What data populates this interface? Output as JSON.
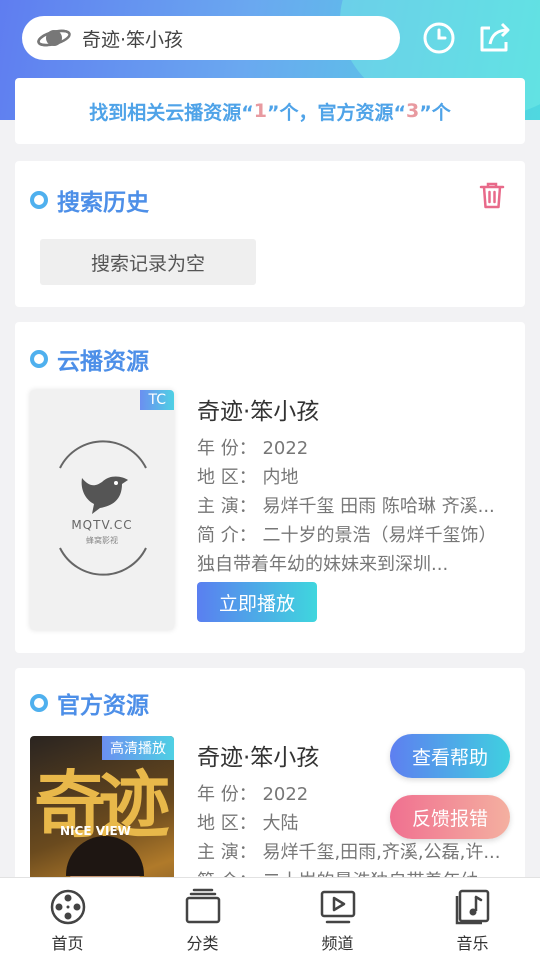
{
  "header": {
    "search_query": "奇迹·笨小孩",
    "clock_icon": "clock-icon",
    "share_icon": "share-icon"
  },
  "result_summary": {
    "prefix": "找到相关云播资源“",
    "cloud_count": "1",
    "middle": "”个，官方资源“",
    "official_count": "3",
    "suffix": "”个"
  },
  "history": {
    "title": "搜索历史",
    "empty_label": "搜索记录为空"
  },
  "cloud": {
    "title": "云播资源",
    "tag": "TC",
    "poster_logo_text": "MQTV.CC",
    "poster_logo_sub": "蜂窝影视",
    "name": "奇迹·笨小孩",
    "year": "年 份： 2022",
    "region": "地 区： 内地",
    "cast": "主 演： 易烊千玺 田雨 陈哈琳 齐溪...",
    "desc": "简 介： 二十岁的景浩（易烊千玺饰）独自带着年幼的妹妹来到深圳...",
    "play_label": "立即播放"
  },
  "official": {
    "title": "官方资源",
    "tag": "高清播放",
    "poster_text": "奇迹",
    "poster_sub": "NICE VIEW",
    "name": "奇迹·笨小孩",
    "year": "年 份： 2022",
    "region": "地 区： 大陆",
    "cast": "主 演： 易烊千玺,田雨,齐溪,公磊,许...",
    "desc": "简 介： 二十岁的景浩独自带着年幼"
  },
  "floating": {
    "help_label": "查看帮助",
    "report_label": "反馈报错"
  },
  "nav": [
    {
      "label": "首页",
      "icon": "film-reel-icon"
    },
    {
      "label": "分类",
      "icon": "category-icon"
    },
    {
      "label": "频道",
      "icon": "channel-icon"
    },
    {
      "label": "音乐",
      "icon": "music-icon"
    }
  ],
  "colors": {
    "accent_blue": "#4d8fe8",
    "count_pink": "#e89aa0",
    "report_pink": "#f07090"
  }
}
